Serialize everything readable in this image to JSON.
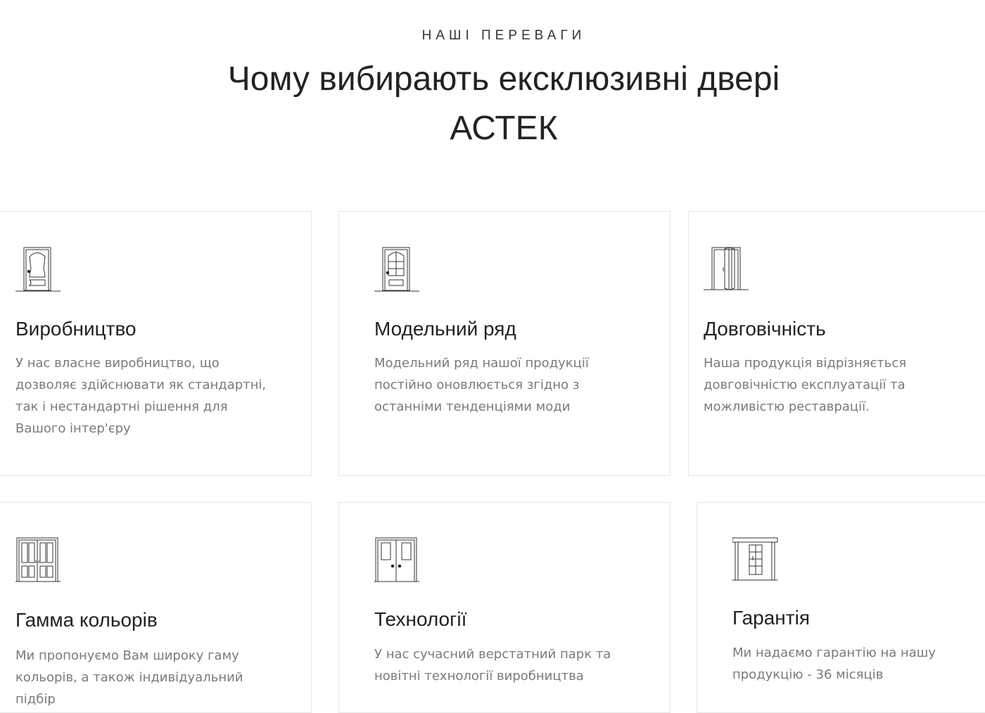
{
  "header": {
    "eyebrow": "НАШІ ПЕРЕВАГИ",
    "title_line1": "Чому вибирають ексклюзивні двері",
    "title_line2": "АСТЕК"
  },
  "cards": [
    {
      "icon": "door-classic-icon",
      "title": "Виробництво",
      "description": "У нас власне виробництво, що дозволяє здійснювати як стандартні, так і нестандартні рішення для Вашого інтер'єру"
    },
    {
      "icon": "door-glass-panel-icon",
      "title": "Модельний ряд",
      "description": "Модельний ряд нашої продукції постійно оновлюється згідно з останніми тенденціями моди"
    },
    {
      "icon": "folding-door-icon",
      "title": "Довговічність",
      "description": "Наша продукція відрізняється довговічністю експлуатації та можливістю реставрації."
    },
    {
      "icon": "double-door-panels-icon",
      "title": "Гамма кольорів",
      "description": "Ми пропонуємо Вам широку гаму кольорів, а також індивідуальний підбір"
    },
    {
      "icon": "double-door-icon",
      "title": "Технології",
      "description": "У нас сучасний верстатний парк та новітні технології виробництва"
    },
    {
      "icon": "door-frame-icon",
      "title": "Гарантія",
      "description": "Ми надаємо гарантію на нашу продукцію - 36 місяців"
    }
  ]
}
